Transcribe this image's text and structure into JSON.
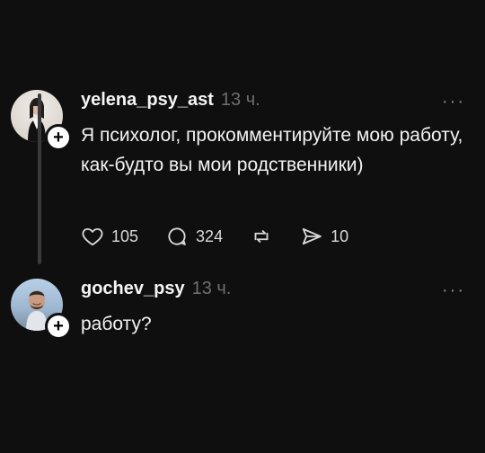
{
  "posts": [
    {
      "username": "yelena_psy_ast",
      "time": "13 ч.",
      "text": "Я психолог, прокомментируйте мою работу, как-будто вы мои родственники)",
      "actions": {
        "likes": "105",
        "comments": "324",
        "repost_icon": "repost-icon",
        "shares": "10"
      }
    },
    {
      "username": "gochev_psy",
      "time": "13 ч.",
      "text": "работу?"
    }
  ],
  "icons": {
    "more": "more-options-icon",
    "plus": "follow-plus-icon",
    "like": "heart-icon",
    "comment": "comment-icon",
    "share": "send-icon"
  },
  "colors": {
    "background": "#0f0f10",
    "text": "#f3f3f3",
    "muted": "#6f6f6f"
  }
}
